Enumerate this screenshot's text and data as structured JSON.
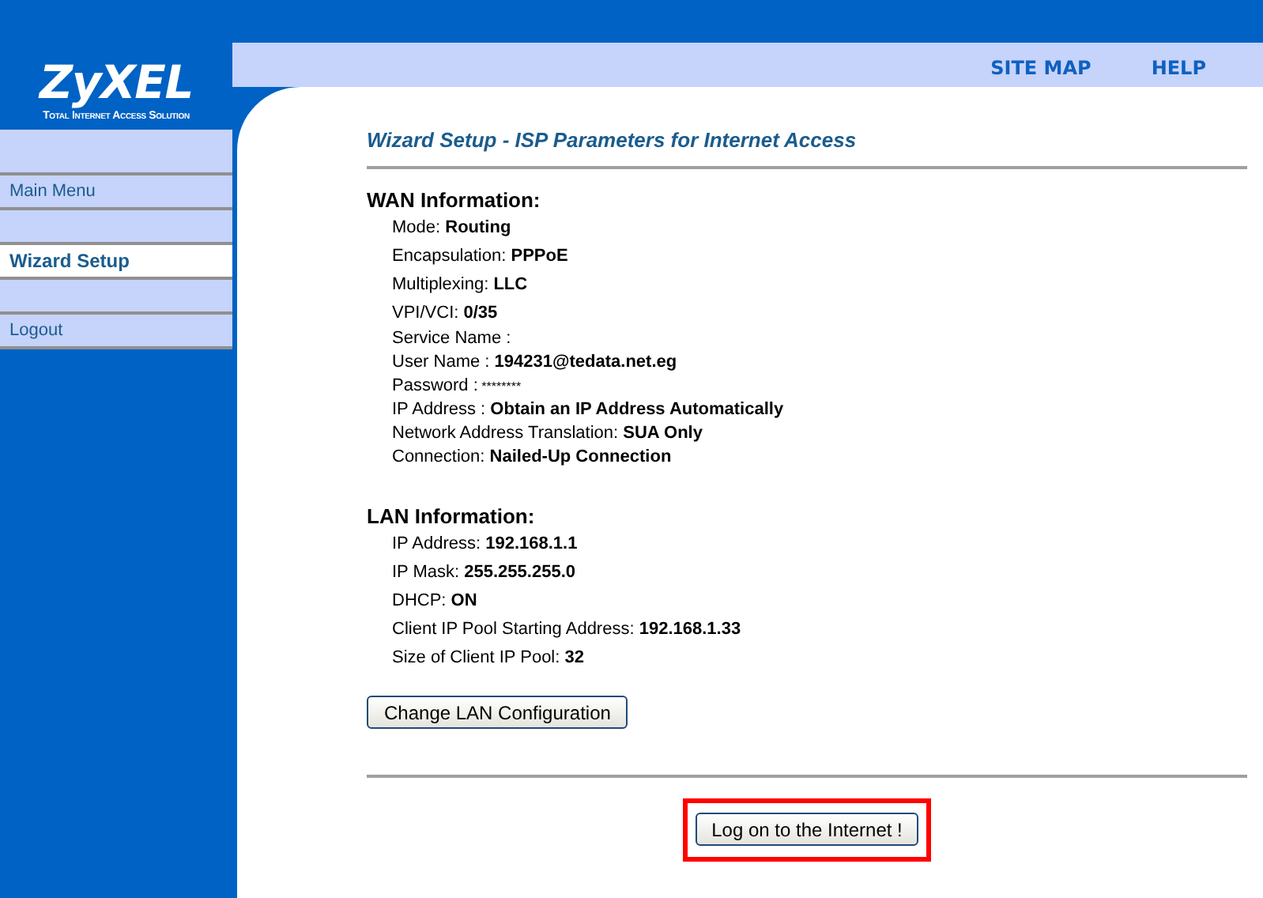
{
  "logo": {
    "name": "ZyXEL",
    "tagline": "Total Internet Access Solution"
  },
  "top_links": [
    "SITE MAP",
    "HELP"
  ],
  "sidebar": {
    "items": [
      {
        "kind": "link",
        "label": "Main Menu",
        "selected": false
      },
      {
        "kind": "blank",
        "selected": false
      },
      {
        "kind": "link",
        "label": "Wizard Setup",
        "selected": true
      },
      {
        "kind": "blank",
        "selected": false
      },
      {
        "kind": "link",
        "label": "Logout",
        "selected": false
      }
    ]
  },
  "page_title": "Wizard Setup - ISP Parameters for Internet Access",
  "sections": [
    {
      "heading": "WAN Information:",
      "rows": [
        {
          "kind": "spaced",
          "label": "Mode:",
          "value": "Routing"
        },
        {
          "kind": "spaced",
          "label": "Encapsulation:",
          "value": "PPPoE"
        },
        {
          "kind": "spaced",
          "label": "Multiplexing:",
          "value": "LLC"
        },
        {
          "kind": "spaced",
          "label": "VPI/VCI:",
          "value": "0/35"
        },
        {
          "kind": "tight",
          "label": "Service Name :"
        },
        {
          "kind": "tight",
          "label": "User Name :",
          "value": "194231@tedata.net.eg"
        },
        {
          "kind": "tight",
          "label": "Password :",
          "secret": "********"
        },
        {
          "kind": "tight",
          "label": "IP Address :",
          "value": "Obtain an IP Address Automatically"
        },
        {
          "kind": "tight",
          "label": "Network Address Translation:",
          "value": "SUA Only"
        },
        {
          "kind": "tight",
          "label": "Connection:",
          "value": "Nailed-Up Connection"
        }
      ]
    },
    {
      "heading": "LAN Information:",
      "rows": [
        {
          "kind": "spaced",
          "label": "IP Address:",
          "value": "192.168.1.1"
        },
        {
          "kind": "spaced",
          "label": "IP Mask:",
          "value": "255.255.255.0"
        },
        {
          "kind": "spaced",
          "label": "DHCP:",
          "value": "ON"
        },
        {
          "kind": "spaced",
          "label": "Client IP Pool Starting Address:",
          "value": "192.168.1.33"
        },
        {
          "kind": "spaced",
          "label": "Size of Client IP Pool:",
          "value": "32"
        }
      ]
    }
  ],
  "lan_button": "Change LAN Configuration",
  "logon_button": {
    "label": "Log on to the Internet !",
    "highlighted": true
  }
}
